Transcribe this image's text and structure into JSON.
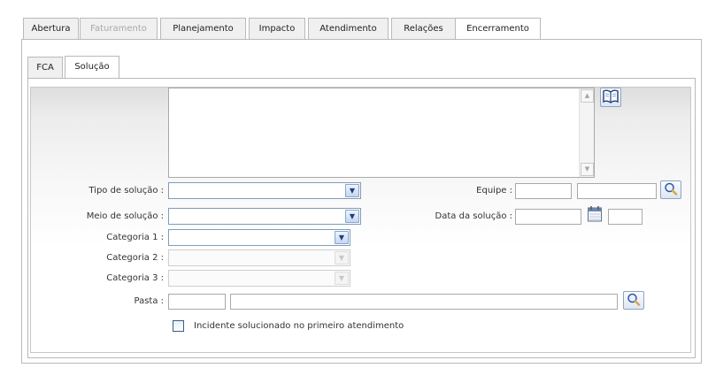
{
  "tabs": [
    {
      "label": "Abertura",
      "state": "normal"
    },
    {
      "label": "Faturamento",
      "state": "disabled"
    },
    {
      "label": "Planejamento",
      "state": "normal"
    },
    {
      "label": "Impacto",
      "state": "normal"
    },
    {
      "label": "Atendimento",
      "state": "normal"
    },
    {
      "label": "Relações",
      "state": "normal"
    },
    {
      "label": "Encerramento",
      "state": "active"
    }
  ],
  "subtabs": [
    {
      "label": "FCA",
      "state": "normal"
    },
    {
      "label": "Solução",
      "state": "active"
    }
  ],
  "solution_text": {
    "value": ""
  },
  "form": {
    "tipo_solucao_label": "Tipo de solução :",
    "tipo_solucao_value": "",
    "meio_solucao_label": "Meio de solução :",
    "meio_solucao_value": "",
    "categoria1_label": "Categoria 1 :",
    "categoria1_value": "",
    "categoria2_label": "Categoria 2 :",
    "categoria2_value": "",
    "categoria3_label": "Categoria 3 :",
    "categoria3_value": "",
    "pasta_label": "Pasta :",
    "pasta_code": "",
    "pasta_desc": "",
    "equipe_label": "Equipe :",
    "equipe_code": "",
    "equipe_name": "",
    "data_solucao_label": "Data da solução :",
    "data_solucao_date": "",
    "data_solucao_time": "",
    "checkbox_label": "Incidente solucionado no primeiro atendimento",
    "checkbox_checked": false
  },
  "icons": {
    "book": "book-icon",
    "search": "magnifier-icon",
    "calendar": "calendar-icon",
    "dropdown": "chevron-down-icon"
  },
  "colors": {
    "tab_border": "#b9b9b9",
    "select_border": "#7f9db9",
    "button_blue": "#213e7a"
  }
}
